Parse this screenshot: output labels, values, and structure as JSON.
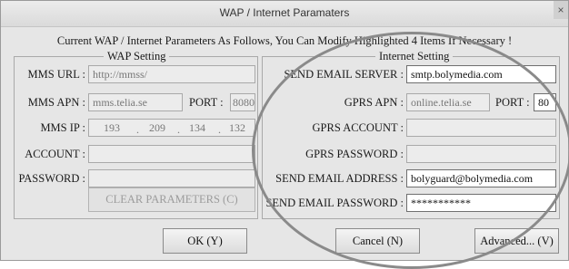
{
  "window": {
    "title": "WAP / Internet Paramaters",
    "close_glyph": "×"
  },
  "notice": "Current WAP / Internet Parameters As Follows, You Can Modify Highlighted 4 Items If Necessary !",
  "wap": {
    "legend": "WAP Setting",
    "mms_url_label": "MMS URL :",
    "mms_url_value": "http://mmss/",
    "mms_apn_label": "MMS APN :",
    "mms_apn_value": "mms.telia.se",
    "port_label": "PORT :",
    "port_value": "8080",
    "mms_ip_label": "MMS IP :",
    "mms_ip": [
      "193",
      "209",
      "134",
      "132"
    ],
    "ip_dot": ".",
    "account_label": "ACCOUNT :",
    "account_value": "",
    "password_label": "PASSWORD :",
    "password_value": "",
    "clear_button": "CLEAR PARAMETERS (C)"
  },
  "internet": {
    "legend": "Internet Setting",
    "send_email_server_label": "SEND EMAIL SERVER :",
    "send_email_server_value": "smtp.bolymedia.com",
    "gprs_apn_label": "GPRS APN :",
    "gprs_apn_value": "online.telia.se",
    "port_label": "PORT :",
    "port_value": "80",
    "gprs_account_label": "GPRS ACCOUNT :",
    "gprs_account_value": "",
    "gprs_password_label": "GPRS PASSWORD :",
    "gprs_password_value": "",
    "send_email_address_label": "SEND EMAIL ADDRESS :",
    "send_email_address_value": "bolyguard@bolymedia.com",
    "send_email_password_label": "SEND EMAIL PASSWORD :",
    "send_email_password_value": "***********"
  },
  "buttons": {
    "ok": "OK (Y)",
    "cancel": "Cancel (N)",
    "advanced": "Advanced... (V)"
  }
}
